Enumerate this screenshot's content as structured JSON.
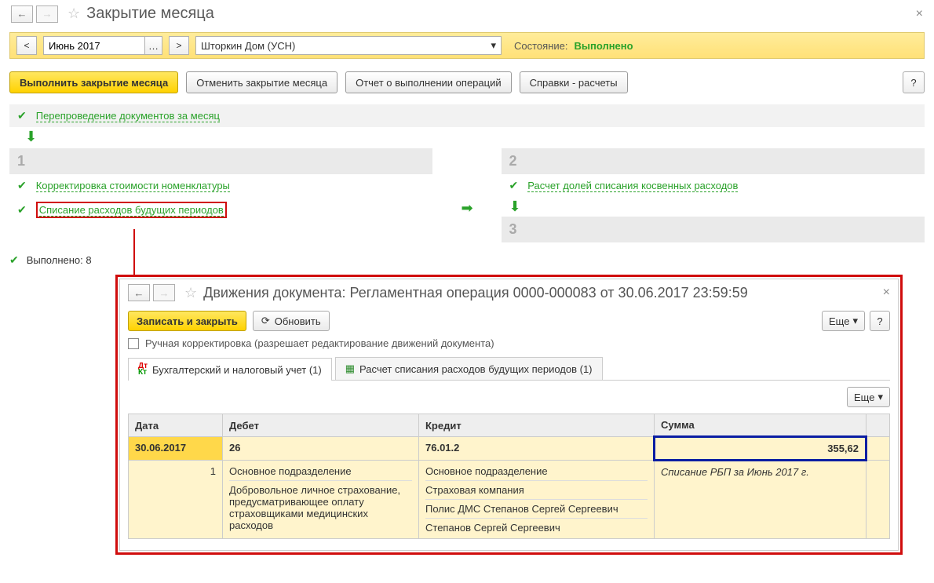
{
  "header": {
    "title": "Закрытие месяца"
  },
  "period": {
    "value": "Июнь 2017",
    "org": "Шторкин Дом (УСН)",
    "status_label": "Состояние:",
    "status_value": "Выполнено"
  },
  "buttons": {
    "execute": "Выполнить закрытие месяца",
    "cancel": "Отменить закрытие месяца",
    "report": "Отчет о выполнении операций",
    "refs": "Справки - расчеты"
  },
  "preop": "Перепроведение документов за месяц",
  "stage1": {
    "num": "1",
    "item1": "Корректировка стоимости номенклатуры",
    "item2": "Списание расходов будущих периодов"
  },
  "stage2": {
    "num": "2",
    "item1": "Расчет долей списания косвенных расходов"
  },
  "stage3": {
    "num": "3"
  },
  "footer": {
    "status": "Выполнено: 8"
  },
  "popup": {
    "title": "Движения документа: Регламентная операция 0000-000083 от 30.06.2017 23:59:59",
    "save": "Записать и закрыть",
    "refresh": "Обновить",
    "more": "Еще",
    "checkbox_label": "Ручная корректировка (разрешает редактирование движений документа)",
    "tab1": "Бухгалтерский и налоговый учет (1)",
    "tab2": "Расчет списания расходов будущих периодов (1)",
    "columns": {
      "date": "Дата",
      "debit": "Дебет",
      "credit": "Кредит",
      "sum": "Сумма"
    },
    "row1": {
      "date": "30.06.2017",
      "debit": "26",
      "credit": "76.01.2",
      "sum": "355,62"
    },
    "row2": {
      "seq": "1",
      "debit_line1": "Основное подразделение",
      "debit_line2": "Добровольное личное страхование, предусматривающее оплату страховщиками медицинских расходов",
      "credit_line1": "Основное подразделение",
      "credit_line2": "Страховая компания",
      "credit_line3": "Полис ДМС Степанов Сергей Сергеевич",
      "credit_line4": "Степанов Сергей Сергеевич",
      "desc": "Списание РБП за Июнь 2017 г."
    }
  }
}
